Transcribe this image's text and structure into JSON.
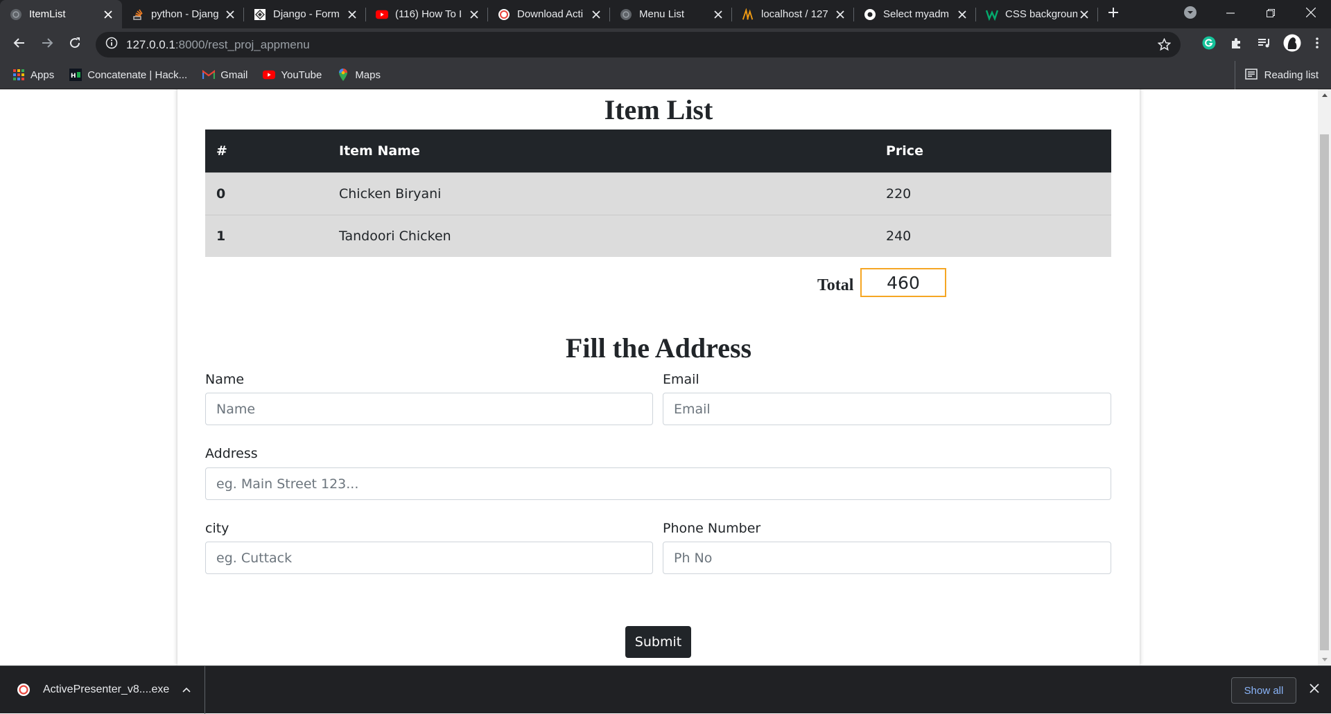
{
  "browser": {
    "tabs": [
      {
        "title": "ItemList",
        "favicon": "globe-icon",
        "active": true
      },
      {
        "title": "python - Djang",
        "favicon": "stackoverflow-icon",
        "active": false
      },
      {
        "title": "Django - Form",
        "favicon": "django-icon",
        "active": false
      },
      {
        "title": "(116) How To I",
        "favicon": "youtube-icon",
        "active": false
      },
      {
        "title": "Download Acti",
        "favicon": "activepresenter-icon",
        "active": false
      },
      {
        "title": "Menu List",
        "favicon": "globe-icon",
        "active": false
      },
      {
        "title": "localhost / 127",
        "favicon": "phpmyadmin-icon",
        "active": false
      },
      {
        "title": "Select myadm",
        "favicon": "chrome-icon",
        "active": false
      },
      {
        "title": "CSS backgroun",
        "favicon": "w3schools-icon",
        "active": false
      }
    ],
    "url_host": "127.0.0.1",
    "url_path": ":8000/rest_proj_appmenu",
    "bookmarks": [
      {
        "label": "Apps",
        "icon": "apps-grid-icon"
      },
      {
        "label": "Concatenate | Hack...",
        "icon": "hackerrank-icon"
      },
      {
        "label": "Gmail",
        "icon": "gmail-icon"
      },
      {
        "label": "YouTube",
        "icon": "youtube-icon"
      },
      {
        "label": "Maps",
        "icon": "maps-icon"
      }
    ],
    "reading_list": "Reading list"
  },
  "page": {
    "title": "Item List",
    "table": {
      "headers": [
        "#",
        "Item Name",
        "Price"
      ],
      "rows": [
        {
          "index": "0",
          "name": "Chicken Biryani",
          "price": "220"
        },
        {
          "index": "1",
          "name": "Tandoori Chicken",
          "price": "240"
        }
      ]
    },
    "total_label": "Total",
    "total_value": "460",
    "form_title": "Fill the Address",
    "form": {
      "name_label": "Name",
      "name_placeholder": "Name",
      "email_label": "Email",
      "email_placeholder": "Email",
      "address_label": "Address",
      "address_placeholder": "eg. Main Street 123...",
      "city_label": "city",
      "city_placeholder": "eg. Cuttack",
      "phone_label": "Phone Number",
      "phone_placeholder": "Ph No",
      "submit_label": "Submit"
    }
  },
  "downloads": {
    "file_name": "ActivePresenter_v8....exe",
    "show_all": "Show all"
  },
  "colors": {
    "table_header_bg": "#212529",
    "table_row_bg": "#dcdcdc",
    "total_border": "#f5a623",
    "submit_bg": "#212529"
  }
}
